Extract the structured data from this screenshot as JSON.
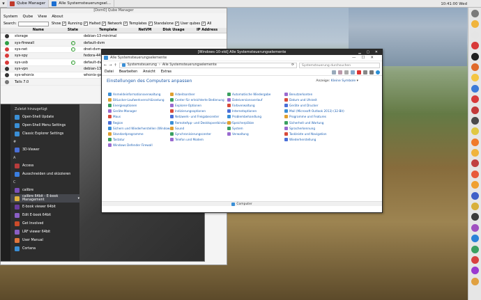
{
  "taskbar": {
    "menu_icon": "tray-menu-icon",
    "tasks": [
      {
        "label": "Qube Manager",
        "color": "#c0392b"
      },
      {
        "label": "Alle Systemsteuerungsel...",
        "color": "#1c6fd1"
      }
    ],
    "clock": "10:41:00 Wed"
  },
  "qube_manager": {
    "title": "[Dom0] Qube Manager",
    "menu": [
      "System",
      "Qube",
      "View",
      "About"
    ],
    "filter": {
      "search_label": "Search:",
      "show_label": "Show",
      "options": [
        "Running",
        "Halted",
        "Network",
        "Templates",
        "Standalone",
        "User qubes",
        "All"
      ]
    },
    "columns": [
      "Name",
      "State",
      "Template",
      "NetVM",
      "Disk Usage",
      "IP Address"
    ],
    "rows": [
      {
        "name": "storage",
        "state": "",
        "template": "debian-13-minimal",
        "netvm": "",
        "color": "#333333"
      },
      {
        "name": "sys-firewall",
        "state": "running",
        "template": "default-dvm",
        "netvm": "",
        "color": "#2e9e44"
      },
      {
        "name": "sys-net",
        "state": "running",
        "template": "dnet-dvm",
        "netvm": "",
        "color": "#d93a3a"
      },
      {
        "name": "sys-spy",
        "state": "",
        "template": "fedora-44",
        "netvm": "",
        "color": "#d93a3a"
      },
      {
        "name": "sys-usb",
        "state": "running",
        "template": "default-dvm",
        "netvm": "",
        "color": "#d93a3a"
      },
      {
        "name": "sys-vpn",
        "state": "",
        "template": "debian-13-minimal",
        "netvm": "",
        "color": "#333333"
      },
      {
        "name": "sys-whonix",
        "state": "",
        "template": "whonix-gateway",
        "netvm": "",
        "color": "#333333"
      },
      {
        "name": "Tails 7.0",
        "state": "",
        "template": "",
        "netvm": "",
        "color": "#777777"
      }
    ]
  },
  "start_menu": {
    "items": [
      {
        "type": "header",
        "label": "Zuletzt hinzugefügt"
      },
      {
        "type": "item",
        "label": "Open-Shell Update",
        "color": "#3a8fd6"
      },
      {
        "type": "item",
        "label": "Open-Shell Menu Settings",
        "color": "#3a8fd6"
      },
      {
        "type": "item",
        "label": "Classic Explorer Settings",
        "color": "#3a8fd6"
      },
      {
        "type": "letter",
        "label": "#"
      },
      {
        "type": "item",
        "label": "3D-Viewer",
        "color": "#4a6fd8"
      },
      {
        "type": "letter",
        "label": "A"
      },
      {
        "type": "item",
        "label": "Access",
        "color": "#b83c3c"
      },
      {
        "type": "item",
        "label": "Ausschneiden und skizzieren",
        "color": "#3a7ee0"
      },
      {
        "type": "letter",
        "label": "C"
      },
      {
        "type": "item",
        "label": "calibre",
        "color": "#7b4fb8"
      },
      {
        "type": "folder",
        "label": "calibre 64bit - E-book Management",
        "color": "#e0b23c"
      },
      {
        "type": "item",
        "label": "E-book viewer 64bit",
        "color": "#6a3c9e"
      },
      {
        "type": "item",
        "label": "Edit E-book 64bit",
        "color": "#8a5fc4"
      },
      {
        "type": "item",
        "label": "Get Involved",
        "color": "#cc4b2a"
      },
      {
        "type": "item",
        "label": "LRF viewer 64bit",
        "color": "#8a5fc4"
      },
      {
        "type": "item",
        "label": "User Manual",
        "color": "#e0753c"
      },
      {
        "type": "item",
        "label": "Cortana",
        "color": "#3a8fd6"
      }
    ]
  },
  "control_panel": {
    "qubes_title": "[Windows-10-std] Alle Systemsteuerungselemente",
    "window_title": "Alle Systemsteuerungselemente",
    "window_controls": [
      "—",
      "☐",
      "✕"
    ],
    "address": [
      "Systemsteuerung",
      "Alle Systemsteuerungselemente"
    ],
    "search_placeholder": "Systemsteuerung durchsuchen",
    "menu": [
      "Datei",
      "Bearbeiten",
      "Ansicht",
      "Extras"
    ],
    "heading": "Einstellungen des Computers anpassen",
    "view_label": "Anzeige:",
    "view_value": "Kleine Symbole",
    "columns": [
      [
        "Anmeldeinformationsverwaltung",
        "BitLocker-Laufwerkverschlüsselung",
        "Energieoptionen",
        "Geräte-Manager",
        "Maus",
        "Region",
        "Sichern und Wiederherstellen (Windows 7)",
        "Standardprogramme",
        "Tastatur",
        "Windows Defender Firewall"
      ],
      [
        "Arbeitsordner",
        "Center für erleichterte Bedienung",
        "Explorer-Optionen",
        "Indizierungsoptionen",
        "Netzwerk- und Freigabecenter",
        "RemoteApp- und Desktopverbindungen",
        "Sound",
        "Synchronisierungscenter",
        "Telefon und Modem"
      ],
      [
        "Automatische Wiedergabe",
        "Dateiversionsverlauf",
        "Farbverwaltung",
        "Internetoptionen",
        "Problembehandlung",
        "Speicherplätze",
        "System",
        "Verwaltung"
      ],
      [
        "Benutzerkonten",
        "Datum und Uhrzeit",
        "Geräte und Drucker",
        "Mail (Microsoft Outlook 2013) (32-Bit)",
        "Programme und Features",
        "Sicherheit und Wartung",
        "Spracherkennung",
        "Taskleiste und Navigation",
        "Wiederherstellung"
      ]
    ],
    "status": "Computer"
  },
  "dock_icons": [
    "#7a7a7a",
    "#f0b43c",
    "#e5e5e5",
    "#d83a3a",
    "#1f1f1f",
    "#e06a2a",
    "#f4c542",
    "#3c7ad8",
    "#d83a3a",
    "#c23a3a",
    "#4a4a4a",
    "#e0c842",
    "#f07a2a",
    "#f0b43c",
    "#c04040",
    "#e85a3a",
    "#f0a030",
    "#4060c8",
    "#d8b03a",
    "#3a3a3a",
    "#a050c0",
    "#2a82d8",
    "#3aa060",
    "#d84040",
    "#9a3ad0",
    "#e0a040"
  ]
}
